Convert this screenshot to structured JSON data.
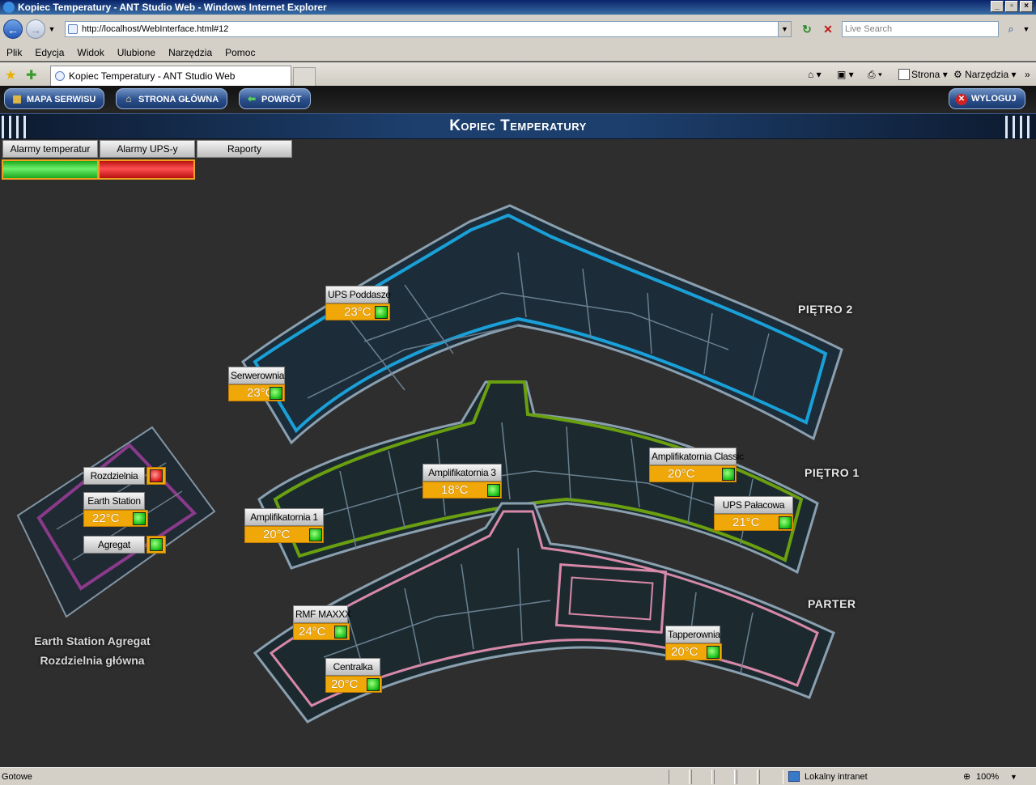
{
  "browser": {
    "window_title": "Kopiec Temperatury - ANT Studio Web - Windows Internet Explorer",
    "url": "http://localhost/WebInterface.html#12",
    "search_placeholder": "Live Search",
    "menu": [
      "Plik",
      "Edycja",
      "Widok",
      "Ulubione",
      "Narzędzia",
      "Pomoc"
    ],
    "tab_title": "Kopiec Temperatury - ANT Studio Web",
    "cmd_page": "Strona",
    "cmd_tools": "Narzędzia",
    "status_text": "Gotowe",
    "status_zone": "Lokalny intranet",
    "status_zoom": "100%"
  },
  "app": {
    "nav": {
      "site_map": "MAPA SERWISU",
      "home": "STRONA GŁÓWNA",
      "back": "POWRÓT",
      "logout": "WYLOGUJ"
    },
    "page_title": "Kopiec Temperatury",
    "controls": [
      "Alarmy temperatur",
      "Alarmy UPS-y",
      "Raporty"
    ],
    "alarm_status": [
      {
        "name": "Alarmy temperatur",
        "state": "ok",
        "color": "#22c022"
      },
      {
        "name": "Alarmy UPS-y",
        "state": "alarm",
        "color": "#e01818"
      }
    ]
  },
  "map": {
    "floors": {
      "floor2": "PIĘTRO 2",
      "floor1": "PIĘTRO 1",
      "ground": "PARTER"
    },
    "floor_colors": {
      "floor2": "#1aa0d8",
      "floor1": "#6aa010",
      "ground": "#d888a8",
      "annex": "#8a3a8a"
    },
    "annex_caption_line1": "Earth Station Agregat",
    "annex_caption_line2": "Rozdzielnia główna"
  },
  "sensors": {
    "ups_poddasze": {
      "name": "UPS Poddasze",
      "temp": "23°C",
      "status": "ok"
    },
    "serwerownia": {
      "name": "Serwerownia",
      "temp": "23°C",
      "status": "ok"
    },
    "rozdzielnia": {
      "name": "Rozdzielnia",
      "status": "alarm"
    },
    "earth_station": {
      "name": "Earth Station",
      "temp": "22°C",
      "status": "ok"
    },
    "agregat": {
      "name": "Agregat",
      "status": "ok"
    },
    "amplifikatornia3": {
      "name": "Amplifikatornia 3",
      "temp": "18°C",
      "status": "ok"
    },
    "amplifikatornia_classic": {
      "name": "Amplifikatornia Classic",
      "temp": "20°C",
      "status": "ok"
    },
    "amplifikatornia1": {
      "name": "Amplifikatornia 1",
      "temp": "20°C",
      "status": "ok"
    },
    "ups_palacowa": {
      "name": "UPS Pałacowa",
      "temp": "21°C",
      "status": "ok"
    },
    "rmf_maxxx": {
      "name": "RMF MAXXX",
      "temp": "24°C",
      "status": "ok"
    },
    "tapperownia": {
      "name": "Tapperownia",
      "temp": "20°C",
      "status": "ok"
    },
    "centralka": {
      "name": "Centralka",
      "temp": "20°C",
      "status": "ok"
    }
  }
}
